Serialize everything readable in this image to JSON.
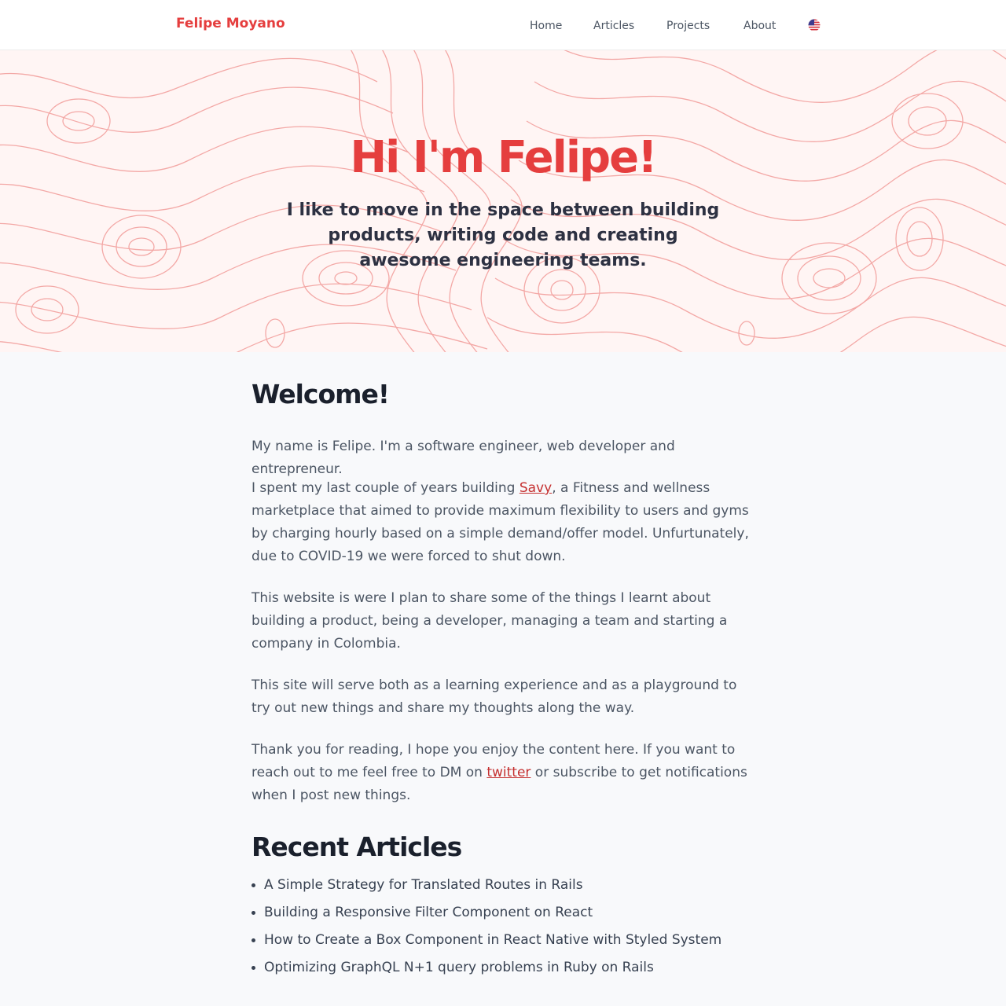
{
  "header": {
    "brand": "Felipe Moyano",
    "nav": {
      "home": "Home",
      "articles": "Articles",
      "projects": "Projects",
      "about": "About"
    },
    "language_icon": "us-flag-icon"
  },
  "hero": {
    "title": "Hi I'm Felipe!",
    "subtitle": "I like to move in the space between building products, writing code and creating awesome engineering teams."
  },
  "welcome": {
    "heading": "Welcome!",
    "p1": "My name is Felipe. I'm a software engineer, web developer and entrepreneur.",
    "p2_before": "I spent my last couple of years building ",
    "p2_link": "Savy",
    "p2_after": ", a Fitness and wellness marketplace that aimed to provide maximum flexibility to users and gyms by charging hourly based on a simple demand/offer model. Unfurtunately, due to COVID-19 we were forced to shut down.",
    "p3": "This website is were I plan to share some of the things I learnt about building a product, being a developer, managing a team and starting a company in Colombia.",
    "p4": "This site will serve both as a learning experience and as a playground to try out new things and share my thoughts along the way.",
    "p5_before": "Thank you for reading, I hope you enjoy the content here. If you want to reach out to me feel free to DM on ",
    "p5_link": "twitter",
    "p5_after": " or subscribe to get notifications when I post new things."
  },
  "recent_articles": {
    "heading": "Recent Articles",
    "items": [
      "A Simple Strategy for Translated Routes in Rails",
      "Building a Responsive Filter Component on React",
      "How to Create a Box Component in React Native with Styled System",
      "Optimizing GraphQL N+1 query problems in Ruby on Rails"
    ]
  },
  "colors": {
    "accent": "#e53e3e",
    "hero_background": "#fff5f4",
    "topo_lines": "#f08f8c",
    "page_background": "#f8f9fb",
    "heading": "#1a202c",
    "body_text": "#4b5563"
  }
}
